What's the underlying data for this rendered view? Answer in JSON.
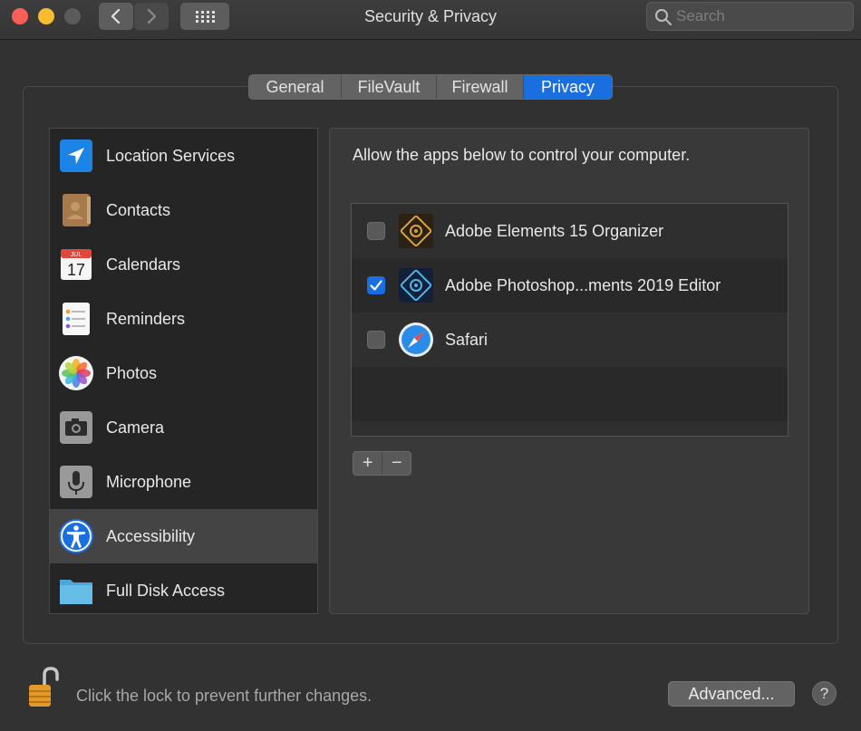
{
  "window": {
    "title": "Security & Privacy",
    "search_placeholder": "Search"
  },
  "tabs": [
    {
      "label": "General",
      "active": false
    },
    {
      "label": "FileVault",
      "active": false
    },
    {
      "label": "Firewall",
      "active": false
    },
    {
      "label": "Privacy",
      "active": true
    }
  ],
  "sidebar": {
    "items": [
      {
        "label": "Location Services",
        "icon": "location-arrow-icon"
      },
      {
        "label": "Contacts",
        "icon": "contacts-book-icon"
      },
      {
        "label": "Calendars",
        "icon": "calendar-icon",
        "icon_month": "JUL",
        "icon_day": "17"
      },
      {
        "label": "Reminders",
        "icon": "reminders-icon"
      },
      {
        "label": "Photos",
        "icon": "photos-flower-icon"
      },
      {
        "label": "Camera",
        "icon": "camera-icon"
      },
      {
        "label": "Microphone",
        "icon": "microphone-icon"
      },
      {
        "label": "Accessibility",
        "icon": "accessibility-icon",
        "selected": true
      },
      {
        "label": "Full Disk Access",
        "icon": "folder-icon"
      }
    ]
  },
  "main": {
    "description": "Allow the apps below to control your computer.",
    "apps": [
      {
        "label": "Adobe Elements 15 Organizer",
        "checked": false,
        "icon": "adobe-organizer-icon"
      },
      {
        "label": "Adobe Photoshop...ments 2019 Editor",
        "checked": true,
        "icon": "adobe-photoshop-elements-icon"
      },
      {
        "label": "Safari",
        "checked": false,
        "icon": "safari-compass-icon"
      }
    ],
    "add_label": "+",
    "remove_label": "−"
  },
  "footer": {
    "lock_text": "Click the lock to prevent further changes.",
    "advanced_label": "Advanced...",
    "help_label": "?"
  },
  "colors": {
    "accent": "#1a6fe0",
    "background": "#333233"
  }
}
